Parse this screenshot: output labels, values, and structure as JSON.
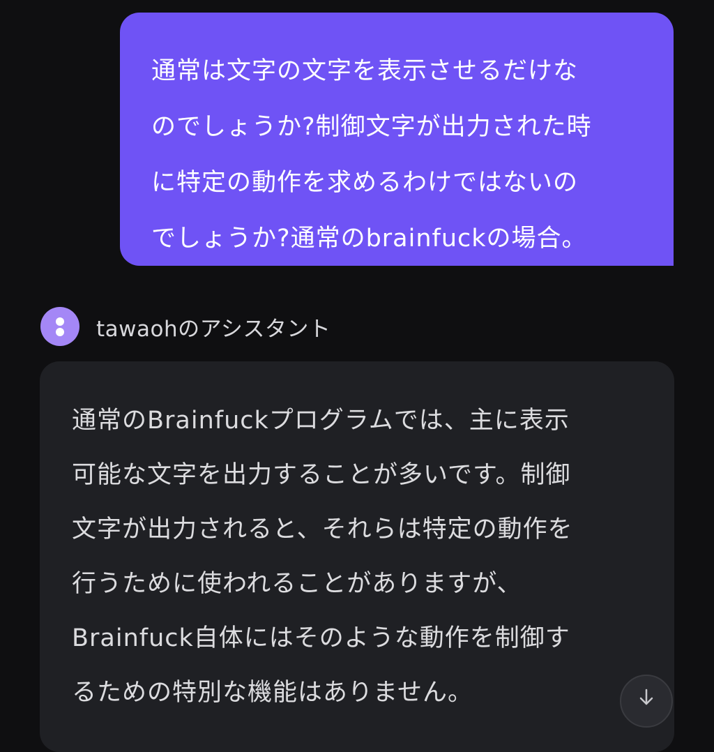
{
  "colors": {
    "background": "#0f0f11",
    "user_bubble": "#6f53f5",
    "assistant_bubble": "#1f2024",
    "avatar": "#a487f6",
    "assistant_text": "#dcdcdf"
  },
  "user_message": {
    "text": "通常は文字の文字を表示させるだけな\nのでしょうか?制御文字が出力された時\nに特定の動作を求めるわけではないの\nでしょうか?通常のbrainfuckの場合。"
  },
  "assistant": {
    "name": "tawaohのアシスタント",
    "avatar_icon": "bot-avatar-icon",
    "message": {
      "text": "通常のBrainfuckプログラムでは、主に表示\n可能な文字を出力することが多いです。制御\n文字が出力されると、それらは特定の動作を\n行うために使われることがありますが、\nBrainfuck自体にはそのような動作を制御す\nるための特別な機能はありません。"
    }
  },
  "scroll_button": {
    "icon": "arrow-down-icon"
  }
}
